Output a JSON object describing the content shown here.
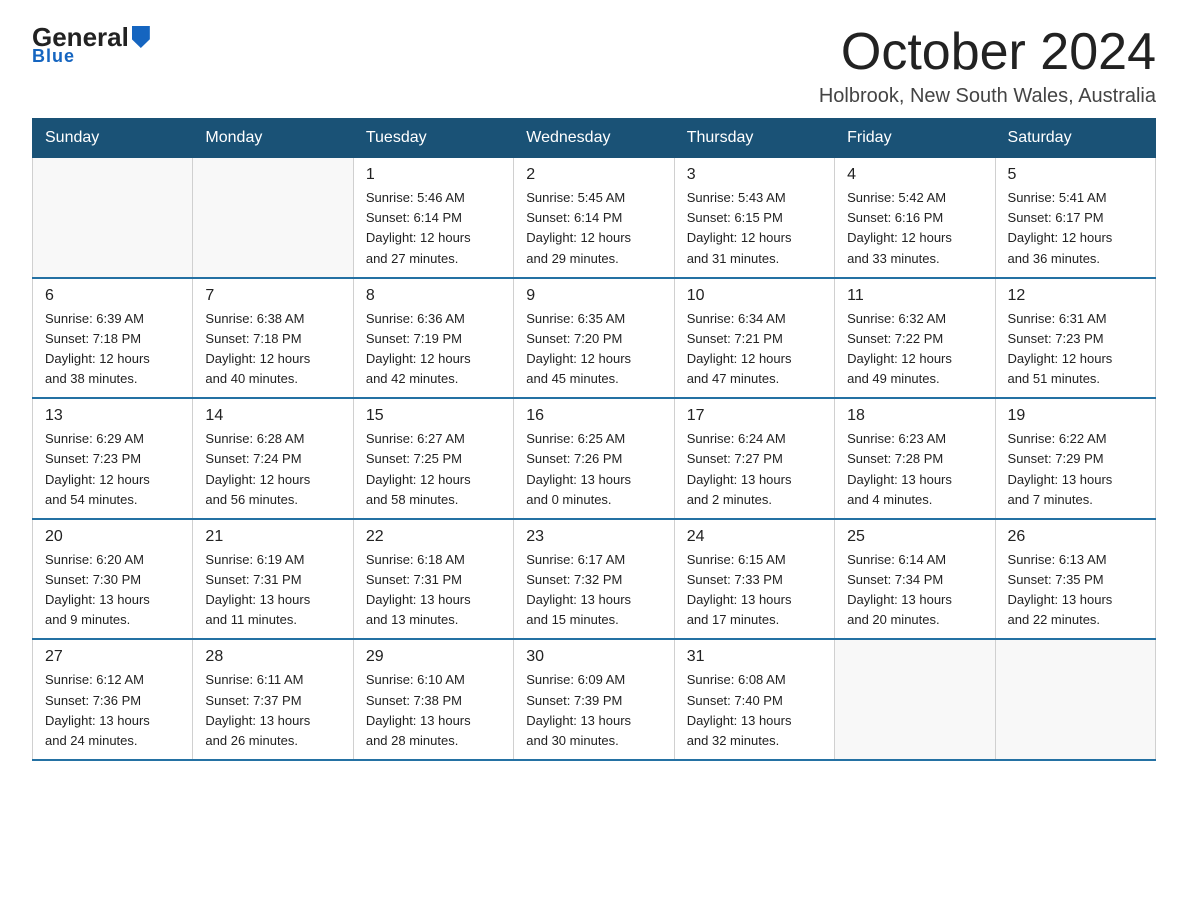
{
  "logo": {
    "general": "General",
    "blue": "Blue"
  },
  "title": "October 2024",
  "subtitle": "Holbrook, New South Wales, Australia",
  "weekdays": [
    "Sunday",
    "Monday",
    "Tuesday",
    "Wednesday",
    "Thursday",
    "Friday",
    "Saturday"
  ],
  "weeks": [
    [
      {
        "day": "",
        "info": ""
      },
      {
        "day": "",
        "info": ""
      },
      {
        "day": "1",
        "info": "Sunrise: 5:46 AM\nSunset: 6:14 PM\nDaylight: 12 hours\nand 27 minutes."
      },
      {
        "day": "2",
        "info": "Sunrise: 5:45 AM\nSunset: 6:14 PM\nDaylight: 12 hours\nand 29 minutes."
      },
      {
        "day": "3",
        "info": "Sunrise: 5:43 AM\nSunset: 6:15 PM\nDaylight: 12 hours\nand 31 minutes."
      },
      {
        "day": "4",
        "info": "Sunrise: 5:42 AM\nSunset: 6:16 PM\nDaylight: 12 hours\nand 33 minutes."
      },
      {
        "day": "5",
        "info": "Sunrise: 5:41 AM\nSunset: 6:17 PM\nDaylight: 12 hours\nand 36 minutes."
      }
    ],
    [
      {
        "day": "6",
        "info": "Sunrise: 6:39 AM\nSunset: 7:18 PM\nDaylight: 12 hours\nand 38 minutes."
      },
      {
        "day": "7",
        "info": "Sunrise: 6:38 AM\nSunset: 7:18 PM\nDaylight: 12 hours\nand 40 minutes."
      },
      {
        "day": "8",
        "info": "Sunrise: 6:36 AM\nSunset: 7:19 PM\nDaylight: 12 hours\nand 42 minutes."
      },
      {
        "day": "9",
        "info": "Sunrise: 6:35 AM\nSunset: 7:20 PM\nDaylight: 12 hours\nand 45 minutes."
      },
      {
        "day": "10",
        "info": "Sunrise: 6:34 AM\nSunset: 7:21 PM\nDaylight: 12 hours\nand 47 minutes."
      },
      {
        "day": "11",
        "info": "Sunrise: 6:32 AM\nSunset: 7:22 PM\nDaylight: 12 hours\nand 49 minutes."
      },
      {
        "day": "12",
        "info": "Sunrise: 6:31 AM\nSunset: 7:23 PM\nDaylight: 12 hours\nand 51 minutes."
      }
    ],
    [
      {
        "day": "13",
        "info": "Sunrise: 6:29 AM\nSunset: 7:23 PM\nDaylight: 12 hours\nand 54 minutes."
      },
      {
        "day": "14",
        "info": "Sunrise: 6:28 AM\nSunset: 7:24 PM\nDaylight: 12 hours\nand 56 minutes."
      },
      {
        "day": "15",
        "info": "Sunrise: 6:27 AM\nSunset: 7:25 PM\nDaylight: 12 hours\nand 58 minutes."
      },
      {
        "day": "16",
        "info": "Sunrise: 6:25 AM\nSunset: 7:26 PM\nDaylight: 13 hours\nand 0 minutes."
      },
      {
        "day": "17",
        "info": "Sunrise: 6:24 AM\nSunset: 7:27 PM\nDaylight: 13 hours\nand 2 minutes."
      },
      {
        "day": "18",
        "info": "Sunrise: 6:23 AM\nSunset: 7:28 PM\nDaylight: 13 hours\nand 4 minutes."
      },
      {
        "day": "19",
        "info": "Sunrise: 6:22 AM\nSunset: 7:29 PM\nDaylight: 13 hours\nand 7 minutes."
      }
    ],
    [
      {
        "day": "20",
        "info": "Sunrise: 6:20 AM\nSunset: 7:30 PM\nDaylight: 13 hours\nand 9 minutes."
      },
      {
        "day": "21",
        "info": "Sunrise: 6:19 AM\nSunset: 7:31 PM\nDaylight: 13 hours\nand 11 minutes."
      },
      {
        "day": "22",
        "info": "Sunrise: 6:18 AM\nSunset: 7:31 PM\nDaylight: 13 hours\nand 13 minutes."
      },
      {
        "day": "23",
        "info": "Sunrise: 6:17 AM\nSunset: 7:32 PM\nDaylight: 13 hours\nand 15 minutes."
      },
      {
        "day": "24",
        "info": "Sunrise: 6:15 AM\nSunset: 7:33 PM\nDaylight: 13 hours\nand 17 minutes."
      },
      {
        "day": "25",
        "info": "Sunrise: 6:14 AM\nSunset: 7:34 PM\nDaylight: 13 hours\nand 20 minutes."
      },
      {
        "day": "26",
        "info": "Sunrise: 6:13 AM\nSunset: 7:35 PM\nDaylight: 13 hours\nand 22 minutes."
      }
    ],
    [
      {
        "day": "27",
        "info": "Sunrise: 6:12 AM\nSunset: 7:36 PM\nDaylight: 13 hours\nand 24 minutes."
      },
      {
        "day": "28",
        "info": "Sunrise: 6:11 AM\nSunset: 7:37 PM\nDaylight: 13 hours\nand 26 minutes."
      },
      {
        "day": "29",
        "info": "Sunrise: 6:10 AM\nSunset: 7:38 PM\nDaylight: 13 hours\nand 28 minutes."
      },
      {
        "day": "30",
        "info": "Sunrise: 6:09 AM\nSunset: 7:39 PM\nDaylight: 13 hours\nand 30 minutes."
      },
      {
        "day": "31",
        "info": "Sunrise: 6:08 AM\nSunset: 7:40 PM\nDaylight: 13 hours\nand 32 minutes."
      },
      {
        "day": "",
        "info": ""
      },
      {
        "day": "",
        "info": ""
      }
    ]
  ]
}
